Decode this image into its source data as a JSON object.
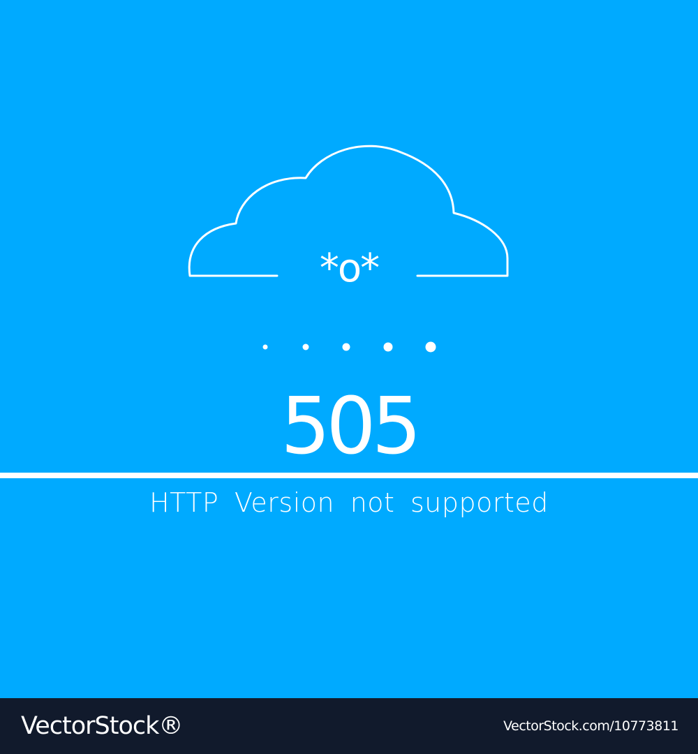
{
  "colors": {
    "background": "#00aaff",
    "foreground": "#ffffff",
    "footer": "#111a2c"
  },
  "illustration": {
    "icon": "cloud-icon",
    "face_text": "*o*",
    "dot_icon": "dot-icon"
  },
  "error": {
    "code": "505",
    "message": "HTTP Version not supported"
  },
  "footer": {
    "brand": "VectorStock®",
    "image_id": "VectorStock.com/10773811"
  }
}
